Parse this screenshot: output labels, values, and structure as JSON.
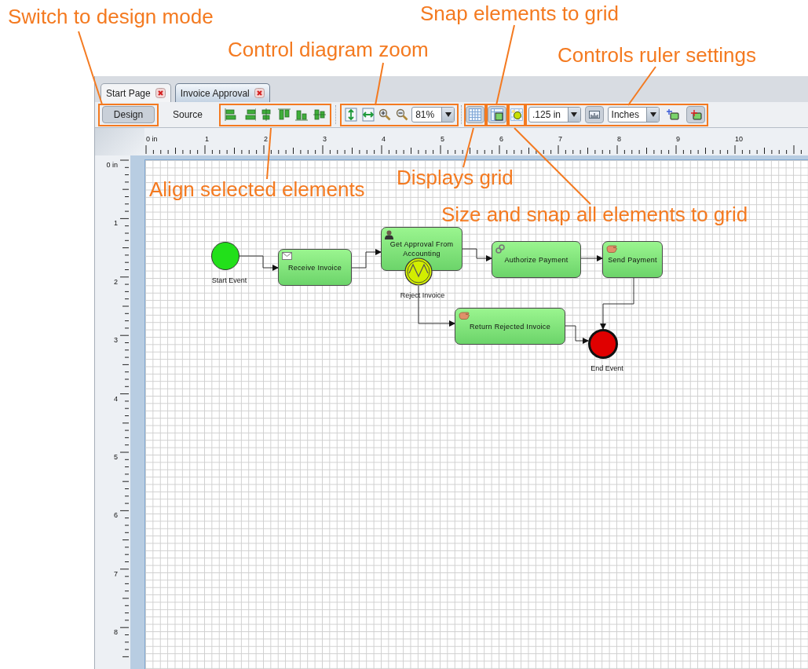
{
  "annotations": [
    "Switch to design mode",
    "Control diagram zoom",
    "Snap elements to grid",
    "Controls ruler settings",
    "Align selected elements",
    "Displays grid",
    "Size and snap all elements to grid"
  ],
  "tabs": [
    {
      "label": "Start Page",
      "selected": false
    },
    {
      "label": "Invoice Approval",
      "selected": true
    }
  ],
  "mode_buttons": [
    {
      "label": "Design",
      "selected": true
    },
    {
      "label": "Source",
      "selected": false
    }
  ],
  "zoom": {
    "value": "81%"
  },
  "grid_buttons": [
    {
      "kind": "show_grid",
      "pressed": true
    },
    {
      "kind": "snap_to_grid",
      "pressed": true
    },
    {
      "kind": "size_and_snap",
      "pressed": false
    }
  ],
  "grid_size": {
    "value": ".125 in"
  },
  "ruler_button": {
    "pressed": true
  },
  "units": {
    "value": "Inches"
  },
  "origin_buttons": [
    {
      "pressed": false
    },
    {
      "pressed": true
    }
  ],
  "ruler": {
    "x_labels": [
      "0 in",
      "1",
      "2",
      "3",
      "4",
      "5",
      "6",
      "7",
      "8",
      "9",
      "10"
    ],
    "y_labels": [
      "0 in",
      "1",
      "2",
      "3",
      "4",
      "5",
      "6",
      "7",
      "8"
    ]
  },
  "diagram": {
    "nodes": [
      {
        "kind": "start_event",
        "label": "Start Event"
      },
      {
        "kind": "receive_task",
        "label": "Receive Invoice"
      },
      {
        "kind": "user_task",
        "label": "Get Approval From Accounting"
      },
      {
        "kind": "boundary_event",
        "label": "Reject Invoice"
      },
      {
        "kind": "service_task",
        "label": "Authorize Payment"
      },
      {
        "kind": "manual_task",
        "label": "Send Payment"
      },
      {
        "kind": "manual_task",
        "label": "Return Rejected Invoice"
      },
      {
        "kind": "end_event",
        "label": "End Event"
      }
    ]
  }
}
